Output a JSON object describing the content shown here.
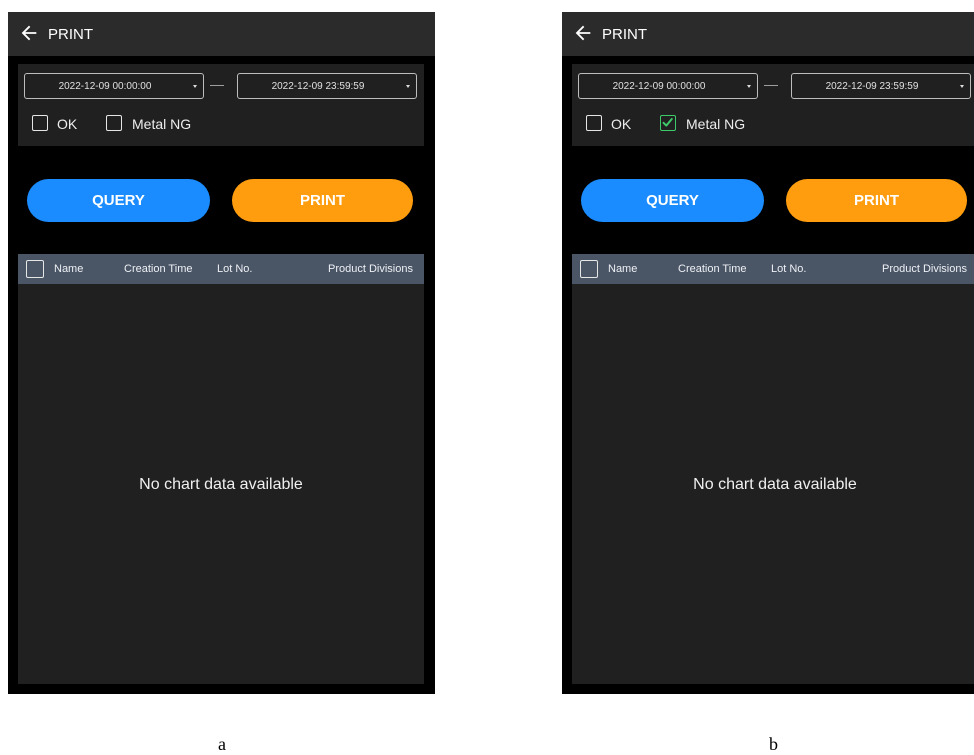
{
  "screens": [
    {
      "caption": "a",
      "title": "PRINT",
      "start_date": "2022-12-09 00:00:00",
      "end_date": "2022-12-09 23:59:59",
      "checkboxes": [
        {
          "label": "OK",
          "checked": false
        },
        {
          "label": "Metal NG",
          "checked": false
        }
      ],
      "query_label": "QUERY",
      "print_label": "PRINT",
      "columns": [
        "Name",
        "Creation Time",
        "Lot No.",
        "Product Divisions"
      ],
      "empty_message": "No chart data available"
    },
    {
      "caption": "b",
      "title": "PRINT",
      "start_date": "2022-12-09 00:00:00",
      "end_date": "2022-12-09 23:59:59",
      "checkboxes": [
        {
          "label": "OK",
          "checked": false
        },
        {
          "label": "Metal NG",
          "checked": true
        }
      ],
      "query_label": "QUERY",
      "print_label": "PRINT",
      "columns": [
        "Name",
        "Creation Time",
        "Lot No.",
        "Product Divisions"
      ],
      "empty_message": "No chart data available"
    }
  ],
  "colors": {
    "query_button": "#1a8cff",
    "print_button": "#ff9d0f",
    "checkmark": "#3ec96b",
    "header_row": "#4a5566"
  },
  "icons": {
    "back": "arrow-left-icon",
    "check": "checkmark-icon",
    "dropdown": "caret-down-icon"
  }
}
